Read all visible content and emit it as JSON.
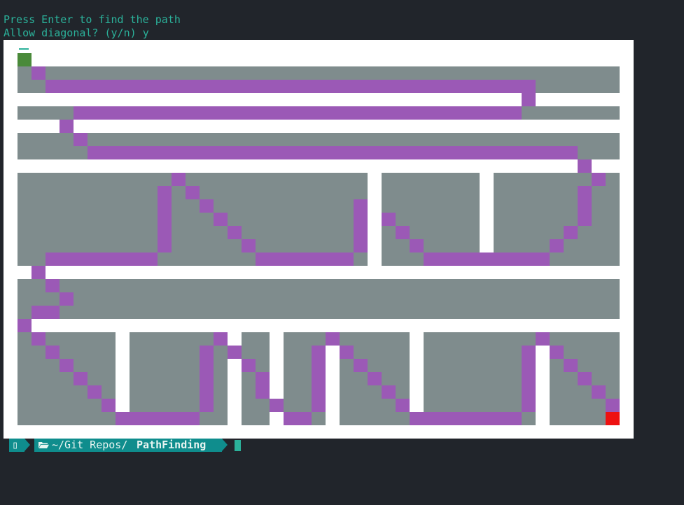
{
  "terminal": {
    "line1": "Press Enter to find the path",
    "line2_prompt": "Allow diagonal? (y/n) ",
    "line2_answer": "y"
  },
  "grid": {
    "cols": 45,
    "rows": 29,
    "cell_colors": {
      "open": "#ffffff",
      "wall": "#7f8c8d",
      "path": "#9b59b6",
      "start": "#4a8a3a",
      "end": "#ee1111"
    },
    "walls": [
      "",
      "",
      "[1,43]",
      "[1,43]",
      "",
      "[1,43]",
      "",
      "[1,43]",
      "[1,43]",
      "",
      "[1,25],[27,33],[35,43]",
      "[1,25],[27,33],[35,43]",
      "[1,25],[27,33],[35,43]",
      "[1,25],[27,33],[35,43]",
      "[1,25],[27,33],[35,43]",
      "[1,25],[27,33],[35,43]",
      "[1,25],[27,33],[35,43]",
      "",
      "[1,43]",
      "[1,43]",
      "[1,43]",
      "",
      "[1,7],[9,15],[17,18],[20,22],[24,28],[30,37],[39,43]",
      "[1,7],[9,15],[17,18],[20,22],[24,28],[30,37],[39,43]",
      "[1,7],[9,15],[17,18],[20,22],[24,28],[30,37],[39,43]",
      "[1,7],[9,15],[17,18],[20,22],[24,28],[30,37],[39,43]",
      "[1,7],[9,15],[17,18],[20,22],[24,28],[30,37],[39,43]",
      "[1,7],[9,15],[17,18],[20,22],[24,28],[30,37],[39,43]",
      "[1,7],[9,15],[17,18],[20,22],[24,28],[30,37],[39,43]",
      ""
    ],
    "path": [
      "",
      "",
      "[2,2]",
      "[3,37]",
      "[37,37]",
      "[5,36]",
      "[4,4]",
      "[5,5]",
      "[6,40]",
      "[41,41]",
      "[12,12],[42,42]",
      "[11,11],[13,13],[41,41]",
      "[11,11],[14,14],[25,25],[41,41]",
      "[11,11],[15,15],[25,25],[27,27],[41,41]",
      "[11,11],[16,16],[25,25],[28,28],[40,40]",
      "[11,11],[17,17],[25,25],[29,29],[39,39]",
      "[3,10],[18,24],[30,38]",
      "[2,2]",
      "[3,3]",
      "[4,4]",
      "[2,3]",
      "[1,1]",
      "[2,2],[15,15],[23,23],[38,38]",
      "[3,3],[14,14],[16,16],[22,22],[24,24],[37,37],[39,39]",
      "[4,4],[14,14],[17,17],[22,22],[25,25],[37,37],[40,40]",
      "[5,5],[14,14],[18,18],[22,22],[26,26],[37,37],[41,41]",
      "[6,6],[14,14],[18,18],[22,22],[27,27],[37,37],[42,42]",
      "[7,7],[14,14],[19,19],[22,22],[28,28],[37,37],[43,43]",
      "[8,13],[20,21],[29,36]",
      ""
    ],
    "start": "[1,1]",
    "end": "[43,28]"
  },
  "prompt": {
    "os_icon": "▯",
    "path_prefix": "~/Git Repos/",
    "path_current": "PathFinding",
    "accent": "#0f8d8d",
    "text_color": "#e6f4f1"
  }
}
